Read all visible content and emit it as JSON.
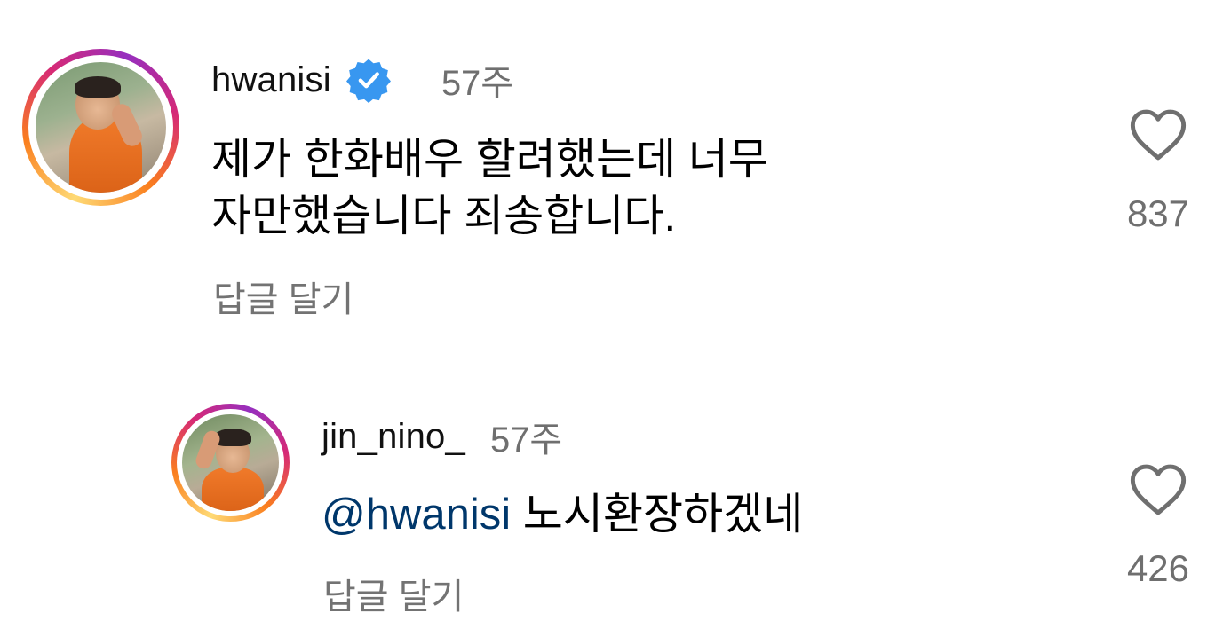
{
  "comments": [
    {
      "username": "hwanisi",
      "verified": true,
      "time": "57주",
      "text_lines": [
        "제가 한화배우 할려했는데 너무",
        "자만했습니다 죄송합니다."
      ],
      "reply_label": "답글 달기",
      "like_icon": "heart-outline-icon",
      "like_count": "837",
      "avatar_icon": "profile-photo-baseball-player"
    },
    {
      "username": "jin_nino_",
      "verified": false,
      "time": "57주",
      "mention": "@hwanisi",
      "text": "노시환장하겠네",
      "reply_label": "답글 달기",
      "like_icon": "heart-outline-icon",
      "like_count": "426",
      "avatar_icon": "profile-photo-baseball-player"
    }
  ],
  "colors": {
    "verified_badge": "#3897f0",
    "mention": "#00376b",
    "secondary_text": "#737373",
    "story_ring_start": "#feda75",
    "story_ring_end": "#962fbf"
  }
}
